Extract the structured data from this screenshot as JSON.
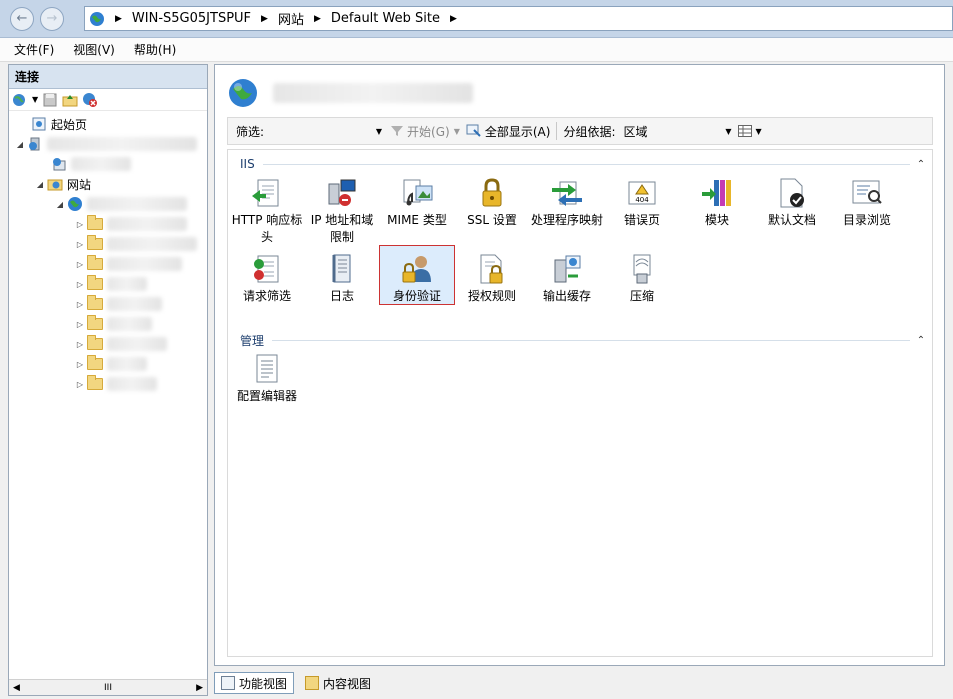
{
  "address_bar": {
    "crumbs": [
      "WIN-S5G05JTSPUF",
      "网站",
      "Default Web Site"
    ]
  },
  "menu": {
    "items": [
      "文件(F)",
      "视图(V)",
      "帮助(H)"
    ]
  },
  "connections": {
    "title": "连接",
    "tree": {
      "start_page": "起始页",
      "sites": "网站"
    },
    "scroll_mid": "III"
  },
  "main": {
    "filter": {
      "label": "筛选:",
      "start_label": "开始(G)",
      "show_all_label": "全部显示(A)",
      "group_by_label": "分组依据:",
      "group_by_value": "区域"
    },
    "groups": [
      {
        "name": "IIS",
        "features": [
          {
            "label": "HTTP 响应标头",
            "icon": "http-response-headers-icon"
          },
          {
            "label": "IP 地址和域限制",
            "icon": "ip-restrictions-icon"
          },
          {
            "label": "MIME 类型",
            "icon": "mime-types-icon"
          },
          {
            "label": "SSL 设置",
            "icon": "ssl-lock-icon"
          },
          {
            "label": "处理程序映射",
            "icon": "handler-mappings-icon"
          },
          {
            "label": "错误页",
            "icon": "error-pages-icon"
          },
          {
            "label": "模块",
            "icon": "modules-icon"
          },
          {
            "label": "默认文档",
            "icon": "default-document-icon"
          },
          {
            "label": "目录浏览",
            "icon": "directory-browsing-icon"
          },
          {
            "label": "请求筛选",
            "icon": "request-filtering-icon"
          },
          {
            "label": "日志",
            "icon": "logging-icon"
          },
          {
            "label": "身份验证",
            "icon": "authentication-icon",
            "selected": true
          },
          {
            "label": "授权规则",
            "icon": "authorization-rules-icon"
          },
          {
            "label": "输出缓存",
            "icon": "output-caching-icon"
          },
          {
            "label": "压缩",
            "icon": "compression-icon"
          }
        ]
      },
      {
        "name": "管理",
        "features": [
          {
            "label": "配置编辑器",
            "icon": "configuration-editor-icon"
          }
        ]
      }
    ],
    "error_badge": "404"
  },
  "bottom_tabs": {
    "feature_view": "功能视图",
    "content_view": "内容视图"
  },
  "colors": {
    "selection_border": "#cc3333",
    "selection_fill": "#dcecfc",
    "header_blue": "#d7e3f0"
  }
}
